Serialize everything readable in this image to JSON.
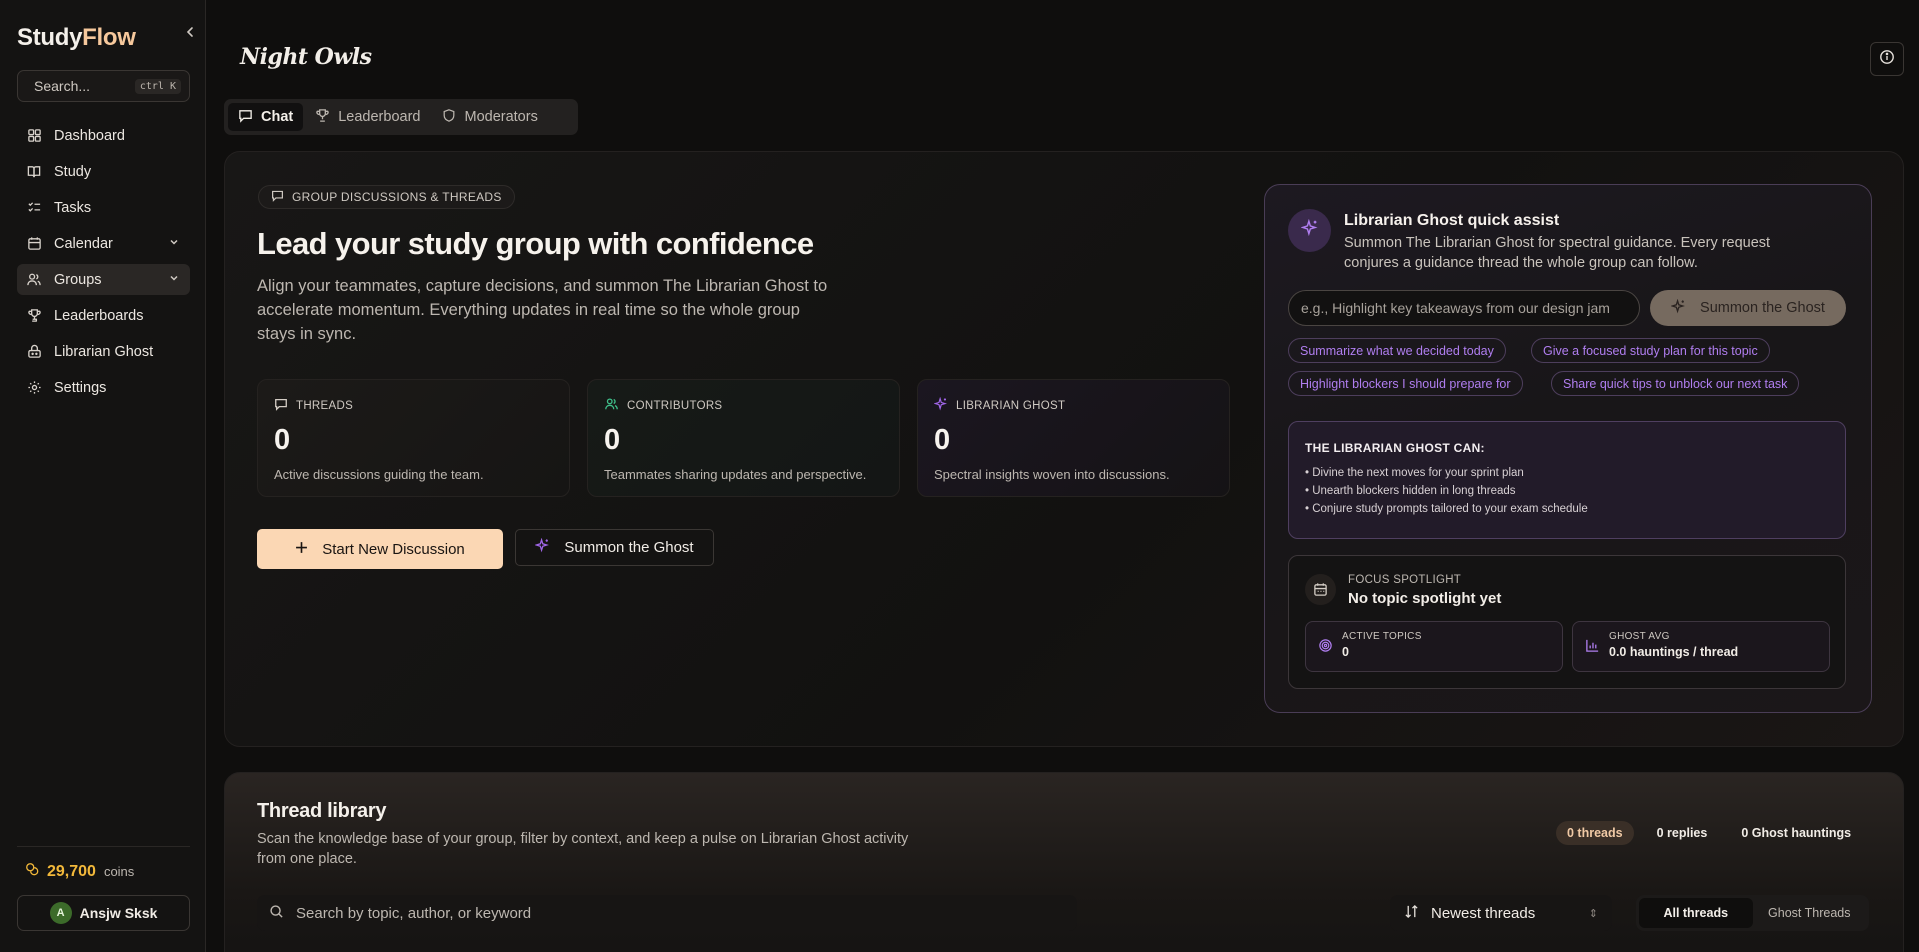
{
  "sidebar": {
    "brand_a": "Study",
    "brand_b": "Flow",
    "search_placeholder": "Search...",
    "search_shortcut": "ctrl K",
    "items": [
      {
        "label": "Dashboard",
        "icon": "grid-icon"
      },
      {
        "label": "Study",
        "icon": "book-icon"
      },
      {
        "label": "Tasks",
        "icon": "checklist-icon"
      },
      {
        "label": "Calendar",
        "icon": "calendar-icon"
      },
      {
        "label": "Groups",
        "icon": "users-icon"
      },
      {
        "label": "Leaderboards",
        "icon": "trophy-icon"
      },
      {
        "label": "Librarian Ghost",
        "icon": "ghost-icon"
      },
      {
        "label": "Settings",
        "icon": "gear-icon"
      }
    ],
    "coins": "29,700",
    "coins_label": "coins",
    "user_initial": "A",
    "user_name": "Ansjw Sksk"
  },
  "header": {
    "group_name": "Night Owls"
  },
  "tabs": [
    {
      "label": "Chat"
    },
    {
      "label": "Leaderboard"
    },
    {
      "label": "Moderators"
    }
  ],
  "hero": {
    "badge": "GROUP DISCUSSIONS & THREADS",
    "title": "Lead your study group with confidence",
    "subtitle": "Align your teammates, capture decisions, and summon The Librarian Ghost to accelerate momentum. Everything updates in real time so the whole group stays in sync.",
    "stats": [
      {
        "label": "THREADS",
        "value": "0",
        "desc": "Active discussions guiding the team."
      },
      {
        "label": "CONTRIBUTORS",
        "value": "0",
        "desc": "Teammates sharing updates and perspective."
      },
      {
        "label": "LIBRARIAN GHOST",
        "value": "0",
        "desc": "Spectral insights woven into discussions."
      }
    ],
    "primary_button": "Start New Discussion",
    "secondary_button": "Summon the Ghost"
  },
  "ghost": {
    "title": "Librarian Ghost quick assist",
    "subtitle": "Summon The Librarian Ghost for spectral guidance. Every request conjures a guidance thread the whole group can follow.",
    "input_placeholder": "e.g., Highlight key takeaways from our design jam",
    "button": "Summon the Ghost",
    "chips": [
      "Summarize what we decided today",
      "Give a focused study plan for this topic",
      "Highlight blockers I should prepare for",
      "Share quick tips to unblock our next task"
    ],
    "can_title": "THE LIBRARIAN GHOST CAN:",
    "can_items": [
      "• Divine the next moves for your sprint plan",
      "• Unearth blockers hidden in long threads",
      "• Conjure study prompts tailored to your exam schedule"
    ],
    "focus_label": "FOCUS SPOTLIGHT",
    "focus_value": "No topic spotlight yet",
    "active_topics_label": "ACTIVE TOPICS",
    "active_topics_value": "0",
    "ghost_avg_label": "GHOST AVG",
    "ghost_avg_value": "0.0 hauntings / thread"
  },
  "library": {
    "title": "Thread library",
    "subtitle": "Scan the knowledge base of your group, filter by context, and keep a pulse on Librarian Ghost activity from one place.",
    "counts": [
      "0 threads",
      "0 replies",
      "0 Ghost hauntings"
    ],
    "search_placeholder": "Search by topic, author, or keyword",
    "sort_value": "Newest threads",
    "filters": [
      "All threads",
      "Ghost Threads"
    ]
  },
  "colors": {
    "accent_peach": "#fbd7b4",
    "ghost_purple": "#b07ef0",
    "coin_gold": "#f2b83a"
  }
}
